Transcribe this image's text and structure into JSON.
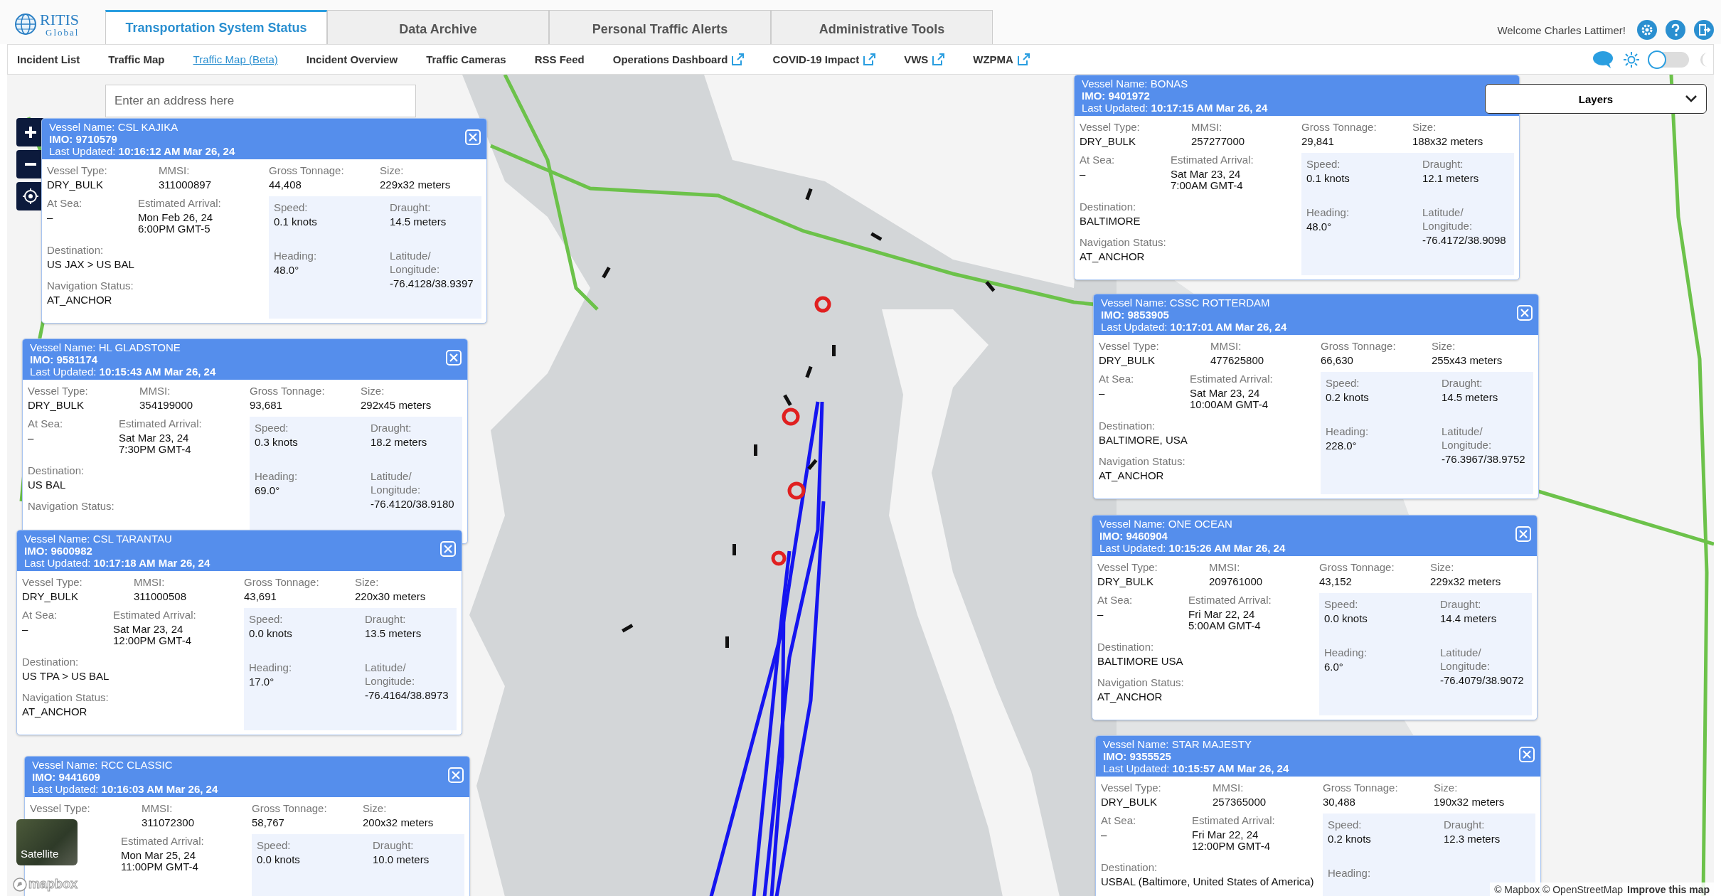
{
  "logo": {
    "name": "RITIS",
    "sub": "Global"
  },
  "tabs": [
    {
      "label": "Transportation System Status",
      "selected": true
    },
    {
      "label": "Data Archive",
      "selected": false
    },
    {
      "label": "Personal Traffic Alerts",
      "selected": false
    },
    {
      "label": "Administrative Tools",
      "selected": false
    }
  ],
  "welcome": "Welcome Charles Lattimer!",
  "nav": [
    {
      "label": "Incident List",
      "selected": false,
      "external": false
    },
    {
      "label": "Traffic Map",
      "selected": false,
      "external": false
    },
    {
      "label": "Traffic Map (Beta)",
      "selected": true,
      "external": false
    },
    {
      "label": "Incident Overview",
      "selected": false,
      "external": false
    },
    {
      "label": "Traffic Cameras",
      "selected": false,
      "external": false
    },
    {
      "label": "RSS Feed",
      "selected": false,
      "external": false
    },
    {
      "label": "Operations Dashboard",
      "selected": false,
      "external": true
    },
    {
      "label": "COVID-19 Impact",
      "selected": false,
      "external": true
    },
    {
      "label": "VWS",
      "selected": false,
      "external": true
    },
    {
      "label": "WZPMA",
      "selected": false,
      "external": true
    }
  ],
  "dark_mode": {
    "on": false
  },
  "map": {
    "search": {
      "placeholder": "Enter an address here"
    },
    "layers": "Layers",
    "satellite": "Satellite",
    "logo": "mapbox",
    "attribution": "© Mapbox © OpenStreetMap",
    "improve": "Improve this map"
  },
  "popups": [
    {
      "name": "Vessel Name: CSL KAJIKA",
      "imo": "IMO: 9710579",
      "updated": "Last Updated: **10:16:12 AM Mar 26, 24**",
      "close": true,
      "summary": [
        {
          "label": "Vessel Type:",
          "value": "DRY_BULK"
        },
        {
          "label": "MMSI:",
          "value": "311000897"
        },
        {
          "label": "Gross Tonnage:",
          "value": "44,408"
        },
        {
          "label": "Size:",
          "value": "229x32 meters"
        }
      ],
      "voyage": [
        {
          "label": "At Sea:",
          "value": "–"
        },
        {
          "label": "Estimated Arrival:",
          "value": "Mon Feb 26, 24\n6:00PM GMT-5"
        }
      ],
      "destination": {
        "label": "Destination:",
        "value": "US JAX > US BAL"
      },
      "navigation": {
        "label": "Navigation Status:",
        "value": "AT_ANCHOR"
      },
      "motion": [
        {
          "label": "Speed:",
          "value": "0.1 knots"
        },
        {
          "label": "Draught:",
          "value": "14.5 meters"
        },
        {
          "label": "Heading:",
          "value": "48.0°"
        },
        {
          "label": "Latitude/\nLongitude:",
          "value": "-76.4128/38.9397"
        }
      ]
    },
    {
      "name": "Vessel Name: HL GLADSTONE",
      "imo": "IMO: 9581174",
      "updated": "Last Updated: **10:15:43 AM Mar 26, 24**",
      "close": true,
      "summary": [
        {
          "label": "Vessel Type:",
          "value": "DRY_BULK"
        },
        {
          "label": "MMSI:",
          "value": "354199000"
        },
        {
          "label": "Gross Tonnage:",
          "value": "93,681"
        },
        {
          "label": "Size:",
          "value": "292x45 meters"
        }
      ],
      "voyage": [
        {
          "label": "At Sea:",
          "value": "–"
        },
        {
          "label": "Estimated Arrival:",
          "value": "Sat Mar 23, 24\n7:30PM GMT-4"
        }
      ],
      "destination": {
        "label": "Destination:",
        "value": "US BAL"
      },
      "navigation": {
        "label": "Navigation Status:"
      },
      "motion": [
        {
          "label": "Speed:",
          "value": "0.3 knots"
        },
        {
          "label": "Draught:",
          "value": "18.2 meters"
        },
        {
          "label": "Heading:",
          "value": "69.0°"
        },
        {
          "label": "Latitude/\nLongitude:",
          "value": "-76.4120/38.9180"
        }
      ]
    },
    {
      "name": "Vessel Name: CSL TARANTAU",
      "imo": "IMO: 9600982",
      "updated": "Last Updated: **10:17:18 AM Mar 26, 24**",
      "close": true,
      "summary": [
        {
          "label": "Vessel Type:",
          "value": "DRY_BULK"
        },
        {
          "label": "MMSI:",
          "value": "311000508"
        },
        {
          "label": "Gross Tonnage:",
          "value": "43,691"
        },
        {
          "label": "Size:",
          "value": "220x30 meters"
        }
      ],
      "voyage": [
        {
          "label": "At Sea:",
          "value": "–"
        },
        {
          "label": "Estimated Arrival:",
          "value": "Sat Mar 23, 24\n12:00PM GMT-4"
        }
      ],
      "destination": {
        "label": "Destination:",
        "value": "US TPA > US BAL"
      },
      "navigation": {
        "label": "Navigation Status:",
        "value": "AT_ANCHOR"
      },
      "motion": [
        {
          "label": "Speed:",
          "value": "0.0 knots"
        },
        {
          "label": "Draught:",
          "value": "13.5 meters"
        },
        {
          "label": "Heading:",
          "value": "17.0°"
        },
        {
          "label": "Latitude/\nLongitude:",
          "value": "-76.4164/38.8973"
        }
      ]
    },
    {
      "name": "Vessel Name: RCC CLASSIC",
      "imo": "IMO: 9441609",
      "updated": "Last Updated: **10:16:03 AM Mar 26, 24**",
      "close": true,
      "summary": [
        {
          "label": "Vessel Type:"
        },
        {
          "label": "MMSI:",
          "value": "311072300"
        },
        {
          "label": "Gross Tonnage:",
          "value": "58,767"
        },
        {
          "label": "Size:",
          "value": "200x32 meters"
        }
      ],
      "voyage": [
        {
          "label": "Estimated Arrival:",
          "value": "Mon Mar 25, 24\n11:00PM GMT-4",
          "kind": "arrival"
        }
      ],
      "motion": [
        {
          "label": "Speed:",
          "value": "0.0 knots"
        },
        {
          "label": "Draught:",
          "value": "10.0 meters"
        }
      ]
    },
    {
      "name": "Vessel Name: BONAS",
      "imo": "IMO: 9401972",
      "updated": "Last Updated: **10:17:15 AM Mar 26, 24**",
      "summary": [
        {
          "label": "Vessel Type:",
          "value": "DRY_BULK"
        },
        {
          "label": "MMSI:",
          "value": "257277000"
        },
        {
          "label": "Gross Tonnage:",
          "value": "29,841"
        },
        {
          "label": "Size:",
          "value": "188x32 meters"
        }
      ],
      "voyage": [
        {
          "label": "At Sea:",
          "value": "–"
        },
        {
          "label": "Estimated Arrival:",
          "value": "Sat Mar 23, 24\n7:00AM GMT-4"
        }
      ],
      "destination": {
        "label": "Destination:",
        "value": "BALTIMORE"
      },
      "navigation": {
        "label": "Navigation Status:",
        "value": "AT_ANCHOR"
      },
      "motion": [
        {
          "label": "Speed:",
          "value": "0.1 knots"
        },
        {
          "label": "Draught:",
          "value": "12.1 meters"
        },
        {
          "label": "Heading:",
          "value": "48.0°"
        },
        {
          "label": "Latitude/\nLongitude:",
          "value": "-76.4172/38.9098"
        }
      ]
    },
    {
      "name": "Vessel Name: CSSC ROTTERDAM",
      "imo": "IMO: 9853905",
      "updated": "Last Updated: **10:17:01 AM Mar 26, 24**",
      "close": true,
      "summary": [
        {
          "label": "Vessel Type:",
          "value": "DRY_BULK"
        },
        {
          "label": "MMSI:",
          "value": "477625800"
        },
        {
          "label": "Gross Tonnage:",
          "value": "66,630"
        },
        {
          "label": "Size:",
          "value": "255x43 meters"
        }
      ],
      "voyage": [
        {
          "label": "At Sea:",
          "value": "–"
        },
        {
          "label": "Estimated Arrival:",
          "value": "Sat Mar 23, 24\n10:00AM GMT-4"
        }
      ],
      "destination": {
        "label": "Destination:",
        "value": "BALTIMORE, USA"
      },
      "navigation": {
        "label": "Navigation Status:",
        "value": "AT_ANCHOR"
      },
      "motion": [
        {
          "label": "Speed:",
          "value": "0.2 knots"
        },
        {
          "label": "Draught:",
          "value": "14.5 meters"
        },
        {
          "label": "Heading:",
          "value": "228.0°"
        },
        {
          "label": "Latitude/\nLongitude:",
          "value": "-76.3967/38.9752"
        }
      ]
    },
    {
      "name": "Vessel Name: ONE OCEAN",
      "imo": "IMO: 9460904",
      "updated": "Last Updated: **10:15:26 AM Mar 26, 24**",
      "close": true,
      "summary": [
        {
          "label": "Vessel Type:",
          "value": "DRY_BULK"
        },
        {
          "label": "MMSI:",
          "value": "209761000"
        },
        {
          "label": "Gross Tonnage:",
          "value": "43,152"
        },
        {
          "label": "Size:",
          "value": "229x32 meters"
        }
      ],
      "voyage": [
        {
          "label": "At Sea:",
          "value": "–"
        },
        {
          "label": "Estimated Arrival:",
          "value": "Fri Mar 22, 24\n5:00AM GMT-4"
        }
      ],
      "destination": {
        "label": "Destination:",
        "value": "BALTIMORE USA"
      },
      "navigation": {
        "label": "Navigation Status:",
        "value": "AT_ANCHOR"
      },
      "motion": [
        {
          "label": "Speed:",
          "value": "0.0 knots"
        },
        {
          "label": "Draught:",
          "value": "14.4 meters"
        },
        {
          "label": "Heading:",
          "value": "6.0°"
        },
        {
          "label": "Latitude/\nLongitude:",
          "value": "-76.4079/38.9072"
        }
      ]
    },
    {
      "name": "Vessel Name: STAR MAJESTY",
      "imo": "IMO: 9355525",
      "updated": "Last Updated: **10:15:57 AM Mar 26, 24**",
      "close": true,
      "summary": [
        {
          "label": "Vessel Type:",
          "value": "DRY_BULK"
        },
        {
          "label": "MMSI:",
          "value": "257365000"
        },
        {
          "label": "Gross Tonnage:",
          "value": "30,488"
        },
        {
          "label": "Size:",
          "value": "190x32 meters"
        }
      ],
      "voyage": [
        {
          "label": "At Sea:",
          "value": "–"
        },
        {
          "label": "Estimated Arrival:",
          "value": "Fri Mar 22, 24\n12:00PM GMT-4"
        }
      ],
      "destination": {
        "label": "Destination:",
        "value": "USBAL (Baltimore, United States of America)"
      },
      "motion": [
        {
          "label": "Speed:",
          "value": "0.2 knots"
        },
        {
          "label": "Draught:",
          "value": "12.3 meters"
        },
        {
          "label": "Heading:"
        }
      ]
    }
  ]
}
